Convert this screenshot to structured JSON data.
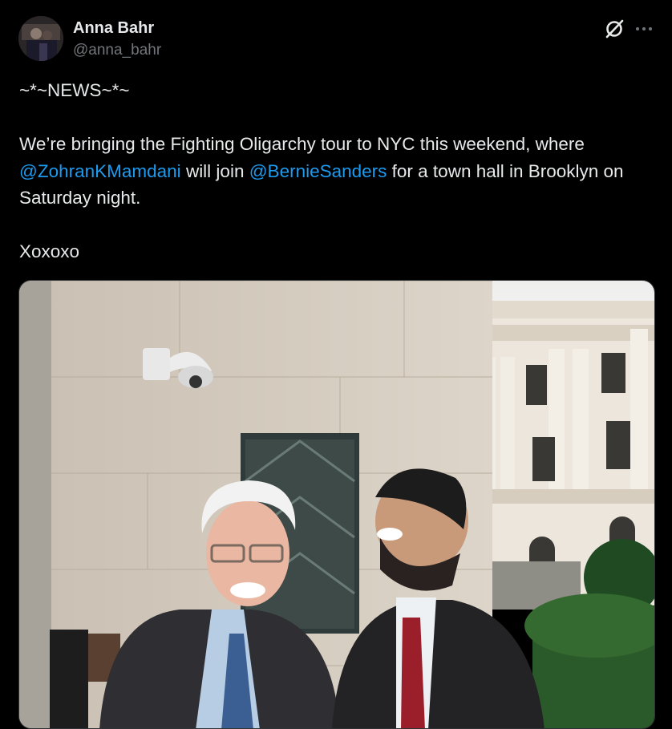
{
  "author": {
    "name": "Anna Bahr",
    "handle": "@anna_bahr",
    "avatar_icon": "profile-photo"
  },
  "header_icons": {
    "grok": "grok-icon",
    "more": "more-options-icon"
  },
  "post": {
    "line1": "~*~NEWS~*~",
    "para_start": "We’re bringing the Fighting Oligarchy tour to NYC this weekend, where ",
    "mention1": "@ZohranKMamdani",
    "mid": " will join ",
    "mention2": "@BernieSanders",
    "para_end": " for a town hall in Brooklyn on Saturday night.",
    "signoff": "Xoxoxo"
  },
  "colors": {
    "background": "#000000",
    "text": "#e7e9ea",
    "secondary": "#71767b",
    "link": "#1d9bf0"
  }
}
